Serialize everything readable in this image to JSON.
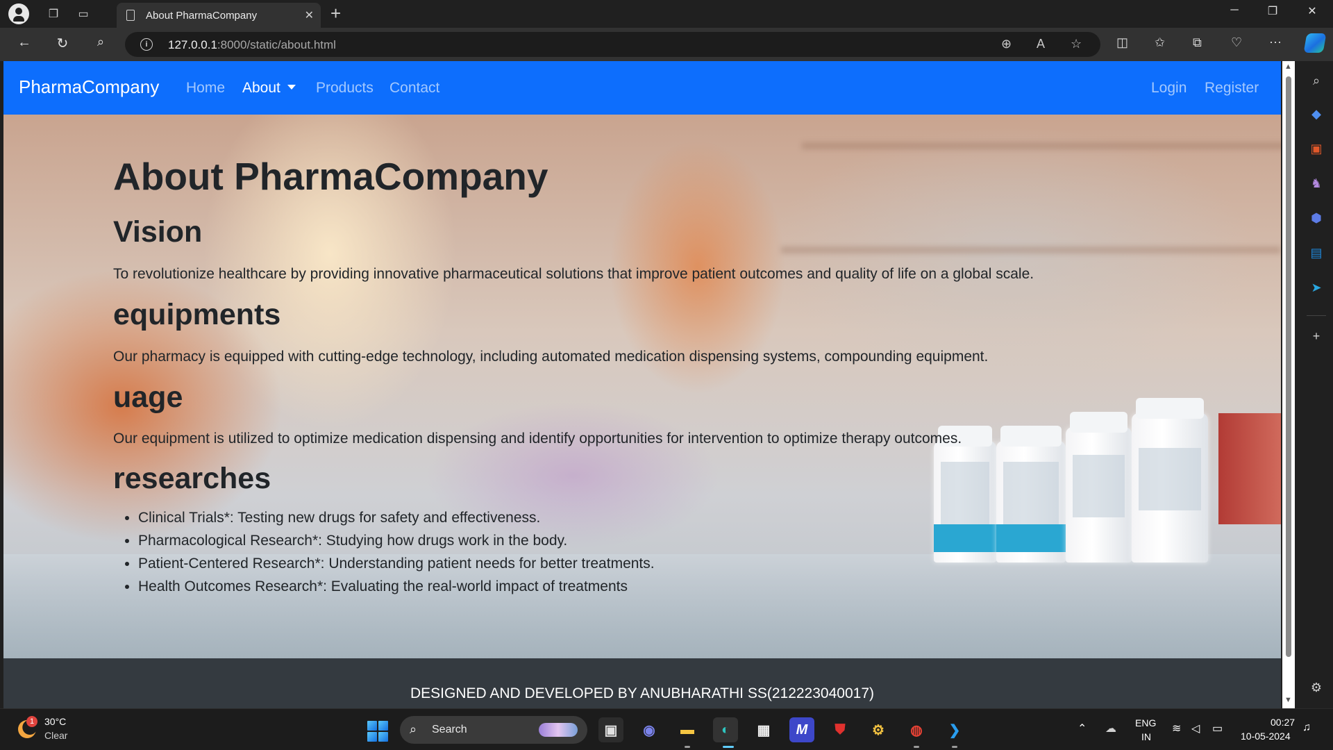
{
  "browser": {
    "tab_title": "About PharmaCompany",
    "url_host": "127.0.0.1",
    "url_rest": ":8000/static/about.html",
    "accent": "#0d6efd"
  },
  "navbar": {
    "brand": "PharmaCompany",
    "links": [
      "Home",
      "About",
      "Products",
      "Contact"
    ],
    "active": "About",
    "right_links": [
      "Login",
      "Register"
    ]
  },
  "content": {
    "title": "About PharmaCompany",
    "sections": [
      {
        "heading": "Vision",
        "text": "To revolutionize healthcare by providing innovative pharmaceutical solutions that improve patient outcomes and quality of life on a global scale."
      },
      {
        "heading": "equipments",
        "text": "Our pharmacy is equipped with cutting-edge technology, including automated medication dispensing systems, compounding equipment."
      },
      {
        "heading": "uage",
        "text": "Our equipment is utilized to optimize medication dispensing and identify opportunities for intervention to optimize therapy outcomes."
      },
      {
        "heading": "researches",
        "items": [
          "Clinical Trials*: Testing new drugs for safety and effectiveness.",
          "Pharmacological Research*: Studying how drugs work in the body.",
          "Patient-Centered Research*: Understanding patient needs for better treatments.",
          "Health Outcomes Research*: Evaluating the real-world impact of treatments"
        ]
      }
    ]
  },
  "footer": {
    "text": "DESIGNED AND DEVELOPED BY ANUBHARATHI SS(212223040017)"
  },
  "taskbar": {
    "weather_temp": "30°C",
    "weather_cond": "Clear",
    "weather_badge": "1",
    "search_label": "Search",
    "lang_top": "ENG",
    "lang_bottom": "IN",
    "time": "00:27",
    "date": "10-05-2024"
  }
}
